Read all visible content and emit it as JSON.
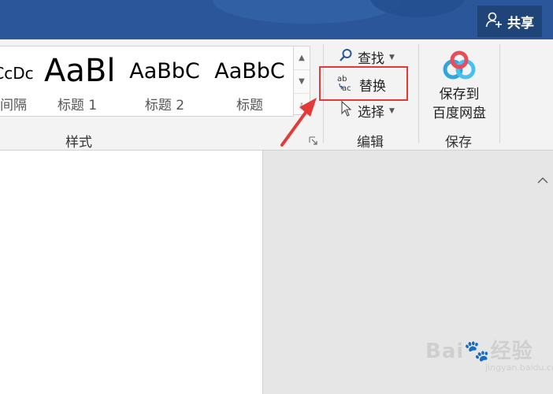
{
  "header": {
    "share_label": "共享"
  },
  "styles_group": {
    "label": "样式",
    "items": [
      {
        "preview": "CcDc",
        "name": "间隔"
      },
      {
        "preview": "AaBl",
        "name": "标题 1"
      },
      {
        "preview": "AaBbC",
        "name": "标题 2"
      },
      {
        "preview": "AaBbC",
        "name": "标题"
      }
    ]
  },
  "edit_group": {
    "label": "编辑",
    "find_label": "查找",
    "replace_label": "替换",
    "select_label": "选择"
  },
  "save_group": {
    "label": "保存",
    "button_line1": "保存到",
    "button_line2": "百度网盘"
  },
  "colors": {
    "accent": "#2b579a",
    "highlight": "#e53935",
    "annotation_arrow": "#e53935"
  },
  "watermark": {
    "brand": "Bai",
    "brand2": "经验",
    "url": "jingyan.baidu.com"
  }
}
